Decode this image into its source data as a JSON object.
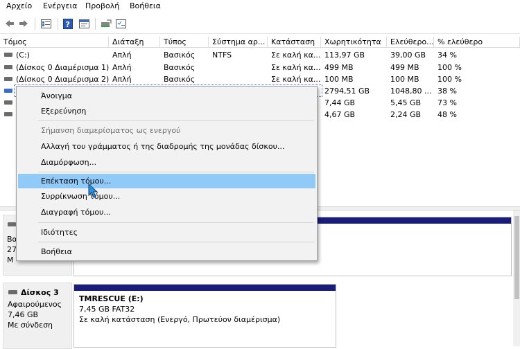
{
  "menu": [
    "Αρχείο",
    "Ενέργεια",
    "Προβολή",
    "Βοήθεια"
  ],
  "toolbar_icons": [
    "back-arrow-icon",
    "forward-arrow-icon",
    "disk-view-icon",
    "help-icon",
    "console-icon",
    "connect-icon",
    "properties-icon"
  ],
  "columns": [
    "Τόμος",
    "Διάταξη",
    "Τύπος",
    "Σύστημα αρ...",
    "Κατάσταση",
    "Χωρητικότητα",
    "Ελεύθερο...",
    "% ελεύθερο"
  ],
  "rows": [
    [
      "(C:)",
      "Απλή",
      "Βασικός",
      "NTFS",
      "Σε καλή κα...",
      "113,97 GB",
      "39,00 GB",
      "34 %"
    ],
    [
      "(Δίσκος 0 Διαμέρισμα 1)",
      "Απλή",
      "Βασικός",
      "",
      "Σε καλή κα...",
      "499 MB",
      "499 MB",
      "100 %"
    ],
    [
      "(Δίσκος 0 Διαμέρισμα 2)",
      "Απλή",
      "Βασικός",
      "",
      "Σε καλή κα...",
      "100 MB",
      "100 MB",
      "100 %"
    ],
    [
      "",
      "",
      "",
      "",
      "",
      "2794,51 GB",
      "1048,80 ...",
      "38 %"
    ],
    [
      "",
      "",
      "",
      "",
      "",
      "7,44 GB",
      "5,45 GB",
      "73 %"
    ],
    [
      "",
      "",
      "",
      "",
      "",
      "4,67 GB",
      "2,24 GB",
      "48 %"
    ]
  ],
  "context_menu": {
    "open": "Άνοιγμα",
    "explore": "Εξερεύνηση",
    "mark_active": "Σήμανση διαμερίσματος ως ενεργού",
    "change_letter": "Αλλαγή  του γράμματος ή της διαδρομής της μονάδας δίσκου...",
    "format": "Διαμόρφωση...",
    "extend": "Επέκταση τόμου...",
    "shrink": "Συρρίκνωση τόμου...",
    "delete": "Διαγραφή τόμου...",
    "properties": "Ιδιότητες",
    "help": "Βοήθεια"
  },
  "disk2_partial": {
    "line1": "Βα",
    "line2": "27",
    "line3": "Μ"
  },
  "disk3": {
    "name": "Δίσκος 3",
    "type": "Αφαιρούμενος",
    "size": "7,46 GB",
    "status": "Με σύνδεση",
    "partition": {
      "title": "TMRESCUE  (E:)",
      "size_fs": "7,45 GB FAT32",
      "status": "Σε καλή κατάσταση (Ενεργό, Πρωτεύον διαμέρισμα)"
    }
  },
  "colors": {
    "partition_bar": "#1a1c7a",
    "highlight": "#91c9f7"
  }
}
